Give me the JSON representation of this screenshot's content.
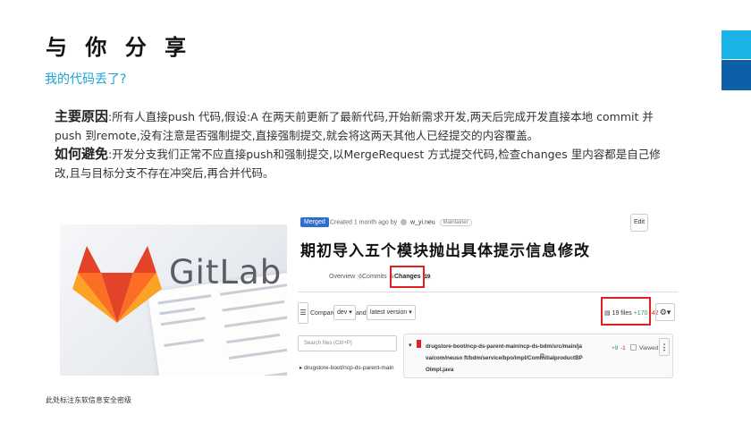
{
  "slide": {
    "title": "与 你 分 享",
    "subtitle": "我的代码丢了?",
    "main_cause_label": "主要原因",
    "main_cause_text": ":所有人直接push 代码,假设:A 在两天前更新了最新代码,开始新需求开发,两天后完成开发直接本地 commit 并push 到remote,没有注意是否强制提交,直接强制提交,就会将这两天其他人已经提交的内容覆盖。",
    "avoid_label": "如何避免",
    "avoid_text": ":开发分支我们正常不应直接push和强制提交,以MergeRequest 方式提交代码,检查changes 里内容都是自己修改,且与目标分支不存在冲突后,再合并代码。",
    "footer": "此处标注东软信息安全密级",
    "accent_colors": [
      "#19b3e6",
      "#0d5fa8"
    ]
  },
  "photo": {
    "wordmark": "GitLab",
    "logo_colors": [
      "#e24329",
      "#fc6d26",
      "#fca326"
    ]
  },
  "mr": {
    "status_badge": "Merged",
    "meta_prefix": "Created 1 month ago by",
    "author": "w_yi.neu",
    "role": "Maintainer",
    "edit_label": "Edit",
    "title": "期初导入五个模块抛出具体提示信息修改",
    "tabs": [
      {
        "label": "Overview",
        "count": "0"
      },
      {
        "label": "Commits",
        "count": "5"
      },
      {
        "label": "Changes",
        "count": "19"
      }
    ],
    "compare_label": "Compare",
    "compare_source": "dev",
    "and_label": "and",
    "compare_target": "latest version",
    "files_count": "19 files",
    "additions": "+170",
    "deletions": "-42",
    "search_placeholder": "Search files (Ctrl+P)",
    "tree_item": "drugstore-boot/ncp-ds-parent-main",
    "file_path": "drugstore-boot/ncp-ds-parent-main/ncp-ds-bdm/src/main/java/com/neuso ft/bdm/service/bpo/impl/ComInitialproductBPOImpl.java",
    "file_additions": "+9",
    "file_deletions": "-1",
    "viewed_label": "Viewed",
    "highlight_color": "#e02020"
  }
}
